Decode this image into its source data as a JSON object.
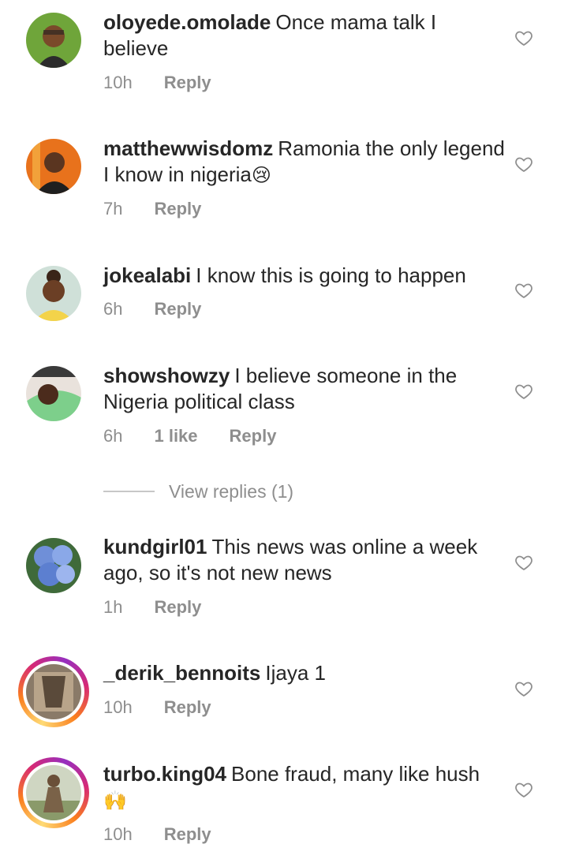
{
  "comments": [
    {
      "username": "oloyede.omolade",
      "text": "Once mama talk I believe",
      "time": "10h",
      "likes": "",
      "reply": "Reply"
    },
    {
      "username": "matthewwisdomz",
      "text": "Ramonia the only legend I know in nigeria",
      "emoji": "😢",
      "time": "7h",
      "likes": "",
      "reply": "Reply"
    },
    {
      "username": "jokealabi",
      "text": "I know this is going to happen",
      "time": "6h",
      "likes": "",
      "reply": "Reply"
    },
    {
      "username": "showshowzy",
      "text": "I believe someone in the Nigeria political class",
      "time": "6h",
      "likes": "1 like",
      "reply": "Reply"
    },
    {
      "username": "kundgirl01",
      "text": "This news was online a week ago, so it's not new news",
      "time": "1h",
      "likes": "",
      "reply": "Reply"
    },
    {
      "username": "_derik_bennoits",
      "text": "Ijaya 1",
      "time": "10h",
      "likes": "",
      "reply": "Reply"
    },
    {
      "username": "turbo.king04",
      "text": "Bone fraud, many like hush",
      "emoji": "🙌",
      "time": "10h",
      "likes": "",
      "reply": "Reply"
    }
  ],
  "view_replies": "View replies (1)",
  "icons": {
    "heart": "heart-outline-icon",
    "avatar": "avatar"
  },
  "colors": {
    "text": "#262626",
    "muted": "#8e8e8e",
    "story_ring": "#d62976"
  }
}
